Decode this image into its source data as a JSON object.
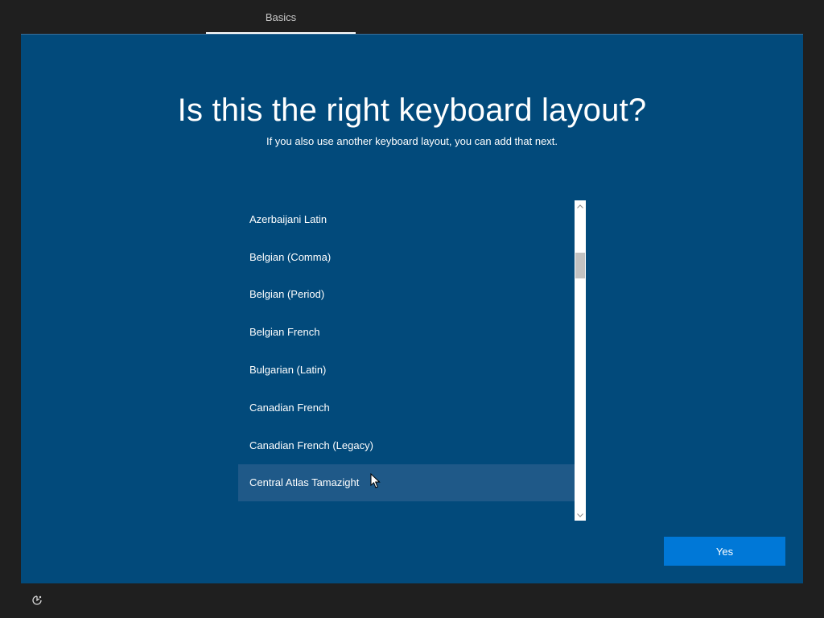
{
  "header": {
    "tab_label": "Basics"
  },
  "main": {
    "title": "Is this the right keyboard layout?",
    "subtitle": "If you also use another keyboard layout, you can add that next.",
    "layouts": [
      "Azerbaijani Latin",
      "Belgian (Comma)",
      "Belgian (Period)",
      "Belgian French",
      "Bulgarian (Latin)",
      "Canadian French",
      "Canadian French (Legacy)",
      "Central Atlas Tamazight"
    ],
    "selected_index": 7,
    "yes_label": "Yes"
  },
  "colors": {
    "background": "#1f1f1f",
    "panel": "#024a7b",
    "selection": "#1f5988",
    "accent_button": "#0078d7"
  },
  "icons": {
    "accessibility": "ease-of-access-icon",
    "scroll_up": "chevron-up-icon",
    "scroll_down": "chevron-down-icon",
    "pointer": "mouse-pointer-icon"
  }
}
